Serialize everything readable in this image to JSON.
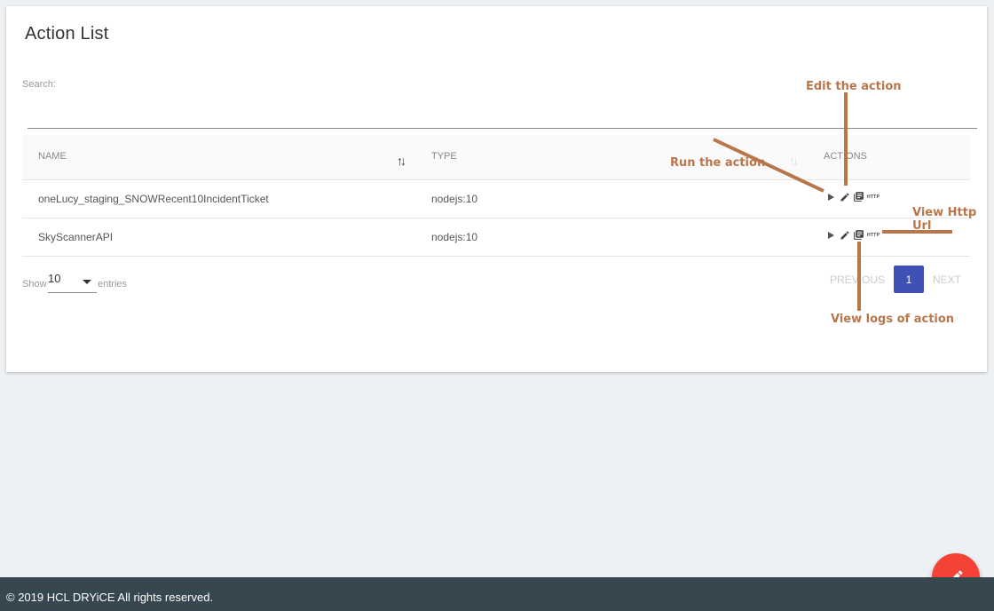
{
  "page": {
    "title": "Action List"
  },
  "search": {
    "label": "Search:",
    "value": "",
    "placeholder": ""
  },
  "table": {
    "columns": [
      "NAME",
      "TYPE",
      "ACTIONS"
    ],
    "rows": [
      {
        "name": "oneLucy_staging_SNOWRecent10IncidentTicket",
        "type": "nodejs:10",
        "http_label": "HTTP"
      },
      {
        "name": "SkyScannerAPI",
        "type": "nodejs:10",
        "http_label": "HTTP"
      }
    ]
  },
  "length": {
    "show_label": "Show",
    "value": "10",
    "entries_label": "entries"
  },
  "pagination": {
    "previous": "PREVIOUS",
    "current": "1",
    "next": "NEXT"
  },
  "annotations": {
    "edit": "Edit the action",
    "run": "Run the action",
    "http": "View Http Url",
    "logs": "View logs of action"
  },
  "footer": {
    "text": "© 2019 HCL DRYiCE All rights reserved."
  },
  "colors": {
    "accent": "#3f51b5",
    "fab": "#f44336",
    "footer": "#37474f",
    "annotation": "#b9764b"
  },
  "icons": {
    "run": "play-icon",
    "edit": "pencil-icon",
    "logs": "document-list-icon",
    "http": "http-icon",
    "sort": "sort-arrows-icon",
    "fab": "pencil-icon"
  }
}
